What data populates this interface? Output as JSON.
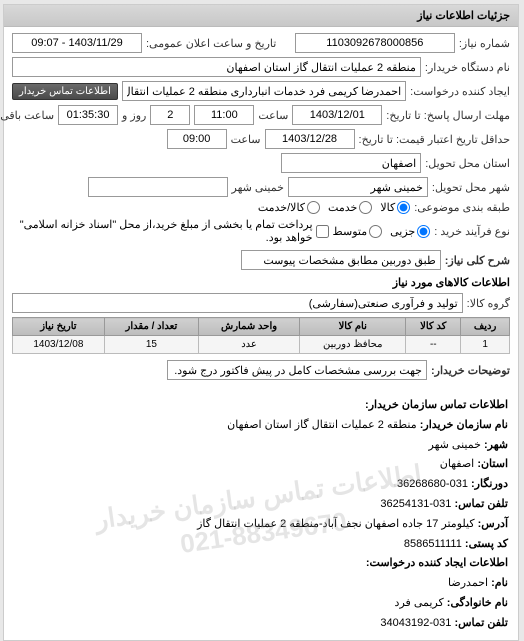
{
  "panel_title": "جزئیات اطلاعات نیاز",
  "need_number_label": "شماره نیاز:",
  "need_number": "1103092678000856",
  "announce_label": "تاریخ و ساعت اعلان عمومی:",
  "announce_value": "1403/11/29 - 09:07",
  "buyer_org_label": "نام دستگاه خریدار:",
  "buyer_org": "منطقه 2 عملیات انتقال گاز استان اصفهان",
  "requester_label": "ایجاد کننده درخواست:",
  "requester": "احمدرضا کریمی فرد خدمات انبارداری منطقه 2 عملیات انتقال گاز استان اصفهان",
  "contact_btn": "اطلاعات تماس خریدار",
  "deadline_label": "مهلت ارسال پاسخ: تا تاریخ:",
  "deadline_date": "1403/12/01",
  "deadline_time_label": "ساعت",
  "deadline_time": "11:00",
  "days_label": "روز و",
  "days": "2",
  "remain_time": "01:35:30",
  "remain_label": "ساعت باقی مانده",
  "validity_label": "حداقل تاریخ اعتبار قیمت: تا تاریخ:",
  "validity_date": "1403/12/28",
  "validity_time_label": "ساعت",
  "validity_time": "09:00",
  "province_label": "استان محل تحویل:",
  "province": "اصفهان",
  "city_label": "شهر محل تحویل:",
  "city": "خمینی شهر",
  "city2_label": "خمینی شهر",
  "category_label": "طبقه بندی موضوعی:",
  "radio_goods": "کالا",
  "radio_service": "خدمت",
  "radio_both": "کالا/خدمت",
  "purchase_type_label": "نوع فرآیند خرید :",
  "radio_minor": "جزیی",
  "radio_medium": "متوسط",
  "purchase_note_check": "پرداخت تمام یا بخشی از مبلغ خرید،از محل \"اسناد خزانه اسلامی\" خواهد بود.",
  "desc_label": "شرح کلی نیاز:",
  "desc_value": "طبق دوربین مطابق مشخصات پیوست",
  "items_title": "اطلاعات کالاهای مورد نیاز",
  "group_label": "گروه کالا:",
  "group_value": "تولید و فرآوری صنعتی(سفارشی)",
  "table": {
    "headers": [
      "ردیف",
      "کد کالا",
      "نام کالا",
      "واحد شمارش",
      "تعداد / مقدار",
      "تاریخ نیاز"
    ],
    "rows": [
      {
        "idx": "1",
        "code": "--",
        "name": "محافظ دوربین",
        "unit": "عدد",
        "qty": "15",
        "date": "1403/12/08"
      }
    ]
  },
  "buyer_notes_label": "توضیحات خریدار:",
  "buyer_notes": "جهت بررسی مشخصات کامل در پیش فاکتور درج شود.",
  "contact_title": "اطلاعات تماس سازمان خریدار:",
  "ci_org_label": "نام سازمان خریدار:",
  "ci_org": "منطقه 2 عملیات انتقال گاز استان اصفهان",
  "ci_city_label": "شهر:",
  "ci_city": "خمینی شهر",
  "ci_province_label": "استان:",
  "ci_province": "اصفهان",
  "ci_fax_label": "دورنگار:",
  "ci_fax": "031-36268680",
  "ci_phone_label": "تلفن تماس:",
  "ci_phone": "031-36254131",
  "ci_address_label": "آدرس:",
  "ci_address": "کیلومتر 17 جاده اصفهان نجف آباد-منطقه 2 عملیات انتقال گاز",
  "ci_postal_label": "کد پستی:",
  "ci_postal": "8586511111",
  "req_creator_title": "اطلاعات ایجاد کننده درخواست:",
  "ci_name_label": "نام:",
  "ci_name": "احمدرضا",
  "ci_family_label": "نام خانوادگی:",
  "ci_family": "کریمی فرد",
  "ci_phone2_label": "تلفن تماس:",
  "ci_phone2": "031-34043192",
  "watermark1": "اطلاعات تماس سازمان خریدار",
  "watermark2": "021-88349670"
}
